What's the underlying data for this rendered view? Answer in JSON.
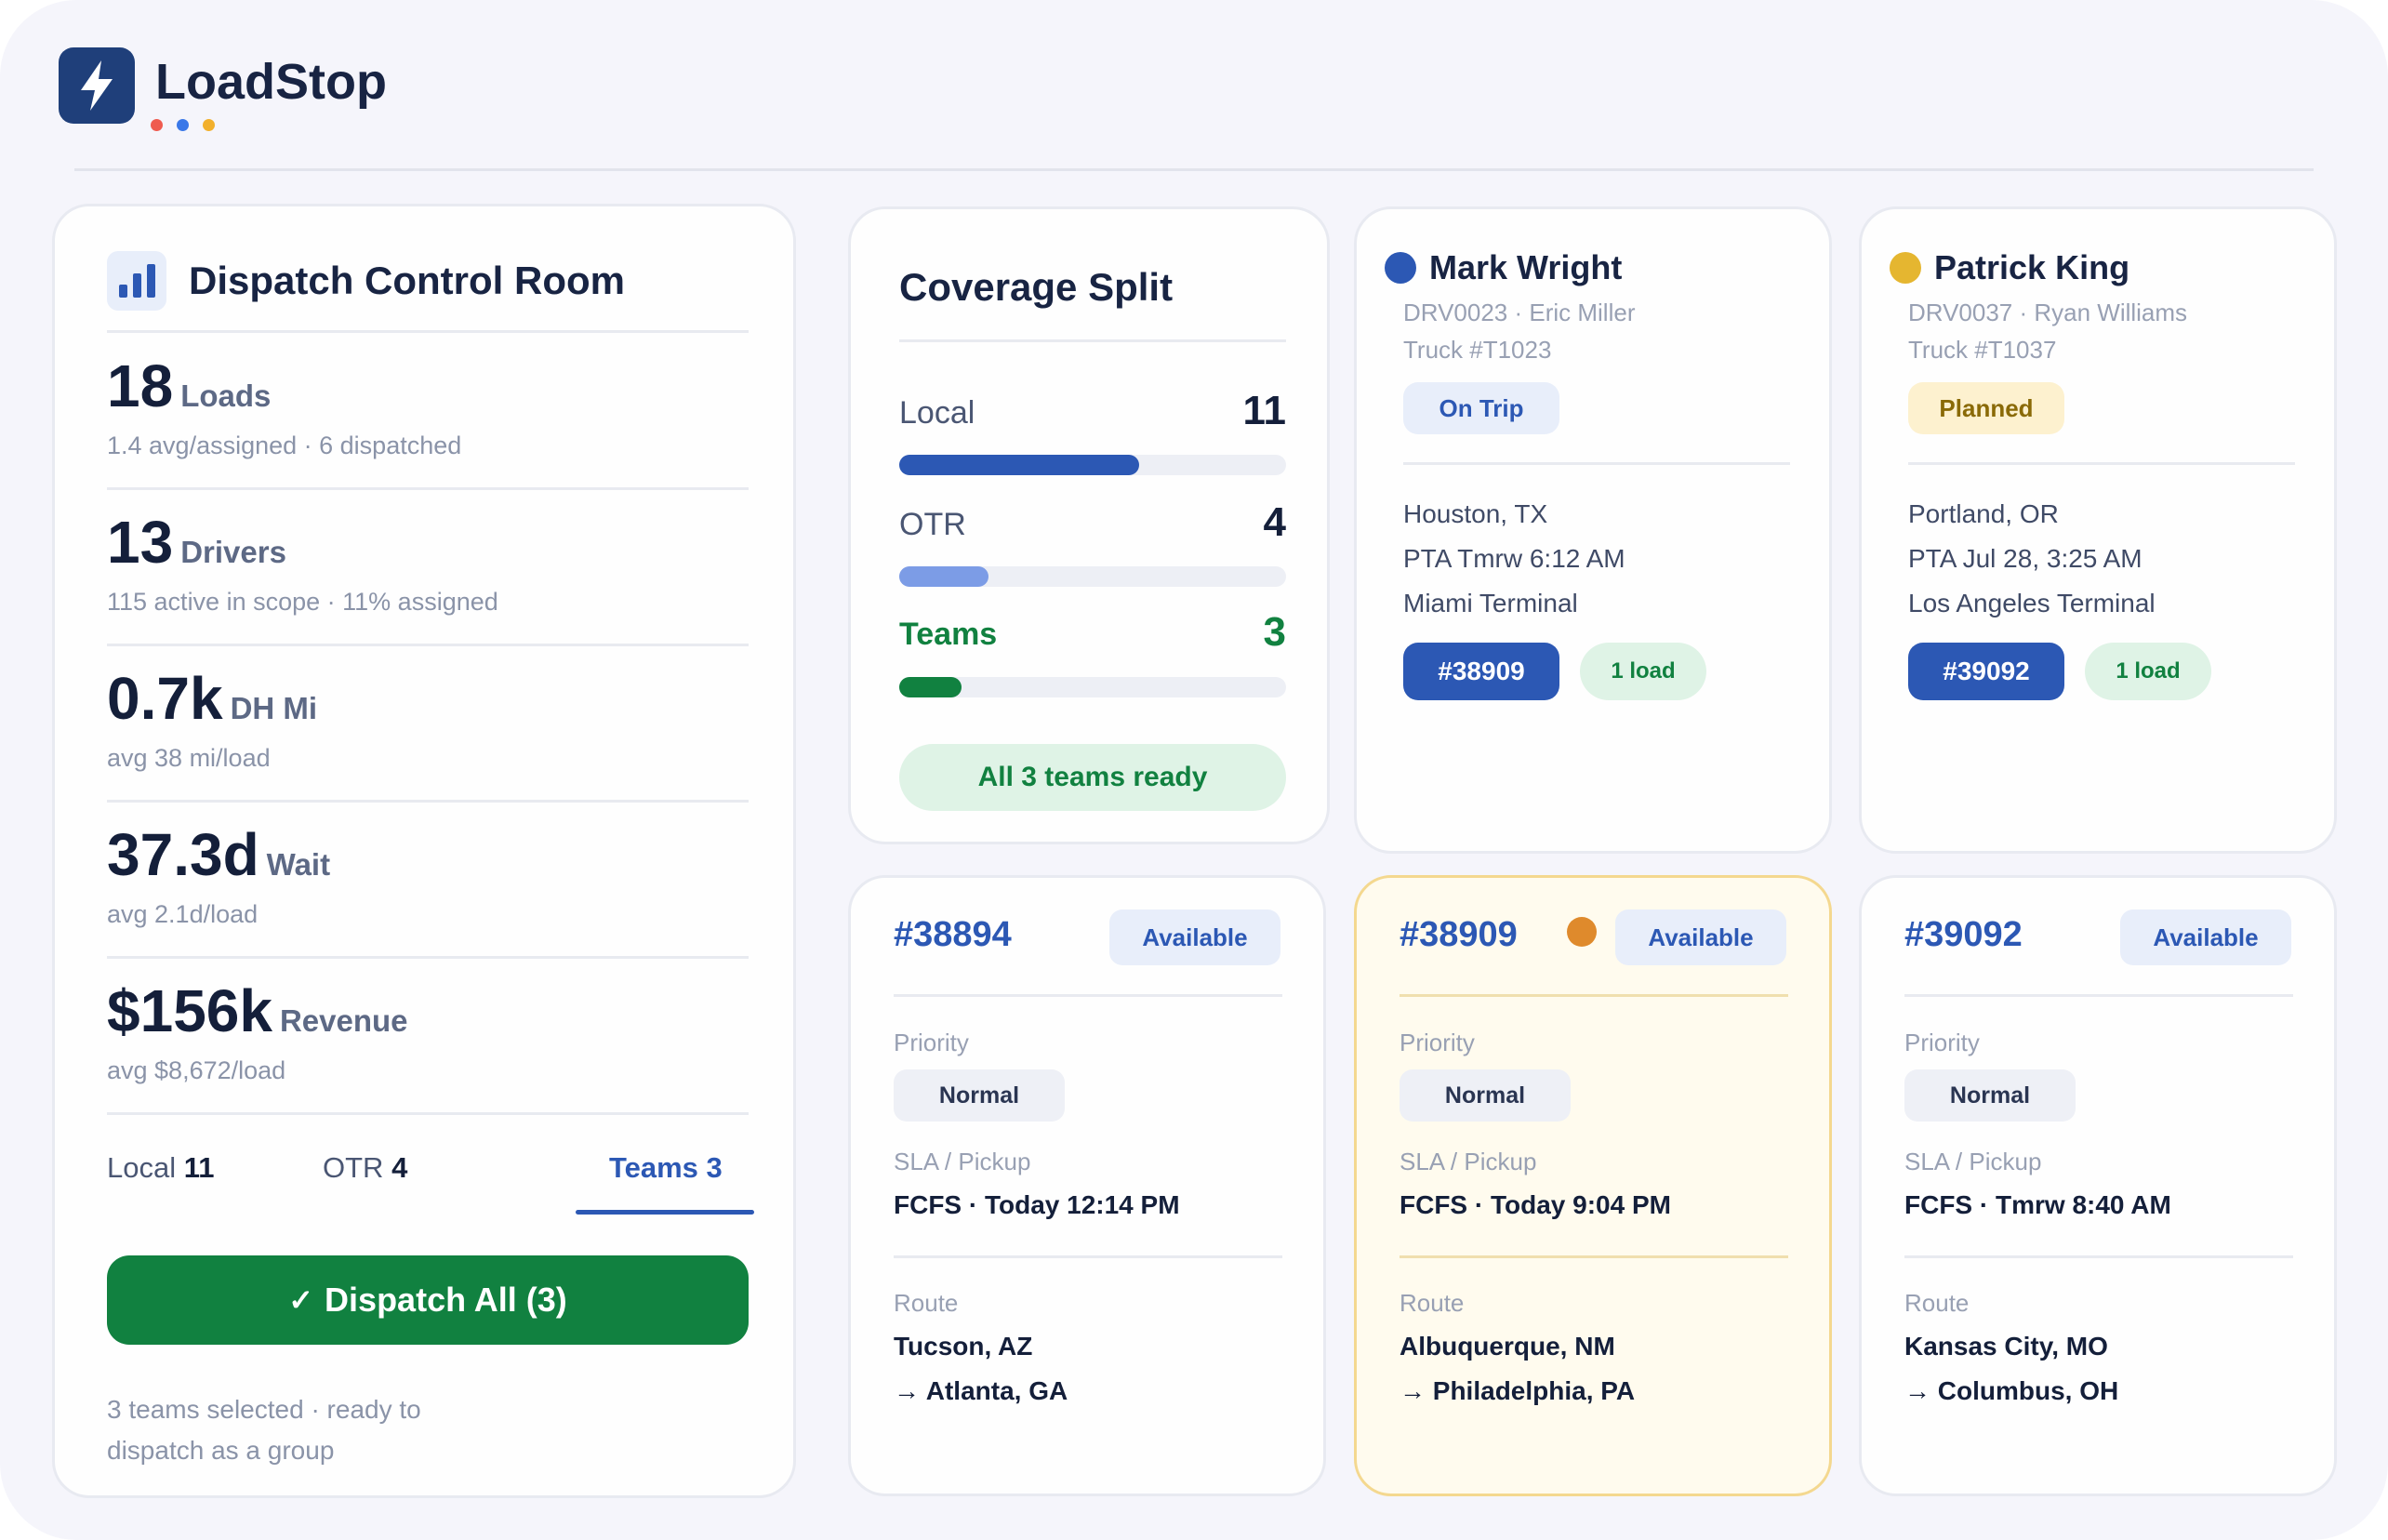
{
  "app": {
    "name": "LoadStop",
    "dot_colors": [
      "#ef5b4f",
      "#3a78e8",
      "#f2b02c"
    ]
  },
  "colors": {
    "primary": "#2c58b4",
    "success": "#118140",
    "navy": "#1f3f7a"
  },
  "summary": {
    "title": "Dispatch Control Room",
    "stats": [
      {
        "value": "18",
        "unit": "Loads",
        "sub": "1.4 avg/assigned · 6 dispatched"
      },
      {
        "value": "13",
        "unit": "Drivers",
        "sub": "115 active in scope · 11% assigned"
      },
      {
        "value": "0.7k",
        "unit": "DH Mi",
        "sub": "avg 38 mi/load"
      },
      {
        "value": "37.3d",
        "unit": "Wait",
        "sub": "avg 2.1d/load"
      },
      {
        "value": "$156k",
        "unit": "Revenue",
        "sub": "avg $8,672/load"
      }
    ],
    "tabs": [
      {
        "label": "Local",
        "count": "11"
      },
      {
        "label": "OTR",
        "count": "4"
      },
      {
        "label": "Teams 3"
      }
    ],
    "active_tab": "Teams",
    "dispatch_button": "Dispatch All (3)",
    "footnote": "3 teams selected · ready to dispatch as a group"
  },
  "coverage": {
    "title": "Coverage Split",
    "rows": [
      {
        "label": "Local",
        "value": "11",
        "fill_fraction": 0.62,
        "color": "#2c58b4"
      },
      {
        "label": "OTR",
        "value": "4",
        "fill_fraction": 0.23,
        "color": "#7c9ce6"
      },
      {
        "label": "Teams",
        "value": "3",
        "fill_fraction": 0.16,
        "color": "#118140"
      }
    ],
    "ready_label": "All 3 teams ready"
  },
  "drivers": [
    {
      "name": "Mark Wright",
      "dot_color": "#2c58b4",
      "id_line": "DRV0023 · Eric Miller",
      "truck": "Truck #T1023",
      "status": "On Trip",
      "location": "Houston, TX",
      "pta": "PTA Tmrw 6:12 AM",
      "terminal": "Miami Terminal",
      "load_id": "#38909",
      "load_count": "1 load"
    },
    {
      "name": "Patrick King",
      "dot_color": "#e5b630",
      "id_line": "DRV0037 · Ryan Williams",
      "truck": "Truck #T1037",
      "status": "Planned",
      "location": "Portland, OR",
      "pta": "PTA Jul 28, 3:25 AM",
      "terminal": "Los Angeles Terminal",
      "load_id": "#39092",
      "load_count": "1 load"
    }
  ],
  "loads": [
    {
      "id": "#38894",
      "status": "Available",
      "priority_label": "Priority",
      "priority": "Normal",
      "sla_label": "SLA / Pickup",
      "sla": "FCFS · Today 12:14 PM",
      "route_label": "Route",
      "origin": "Tucson, AZ",
      "destination": "→ Atlanta, GA"
    },
    {
      "id": "#38909",
      "status": "Available",
      "priority_label": "Priority",
      "priority": "Normal",
      "sla_label": "SLA / Pickup",
      "sla": "FCFS · Today 9:04 PM",
      "route_label": "Route",
      "origin": "Albuquerque, NM",
      "destination": "→ Philadelphia, PA",
      "selected": true
    },
    {
      "id": "#39092",
      "status": "Available",
      "priority_label": "Priority",
      "priority": "Normal",
      "sla_label": "SLA / Pickup",
      "sla": "FCFS · Tmrw 8:40 AM",
      "route_label": "Route",
      "origin": "Kansas City, MO",
      "destination": "→ Columbus, OH"
    }
  ]
}
